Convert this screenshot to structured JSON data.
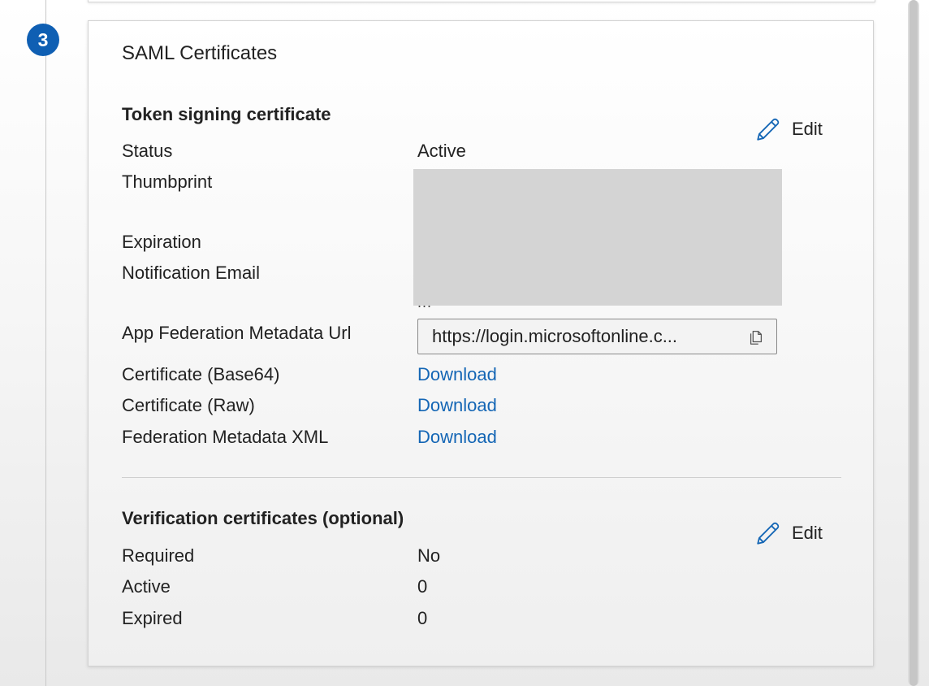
{
  "step": {
    "number": "3"
  },
  "card": {
    "title": "SAML Certificates"
  },
  "token_signing": {
    "title": "Token signing certificate",
    "edit_label": "Edit",
    "rows": [
      {
        "label": "Status",
        "value": "Active"
      },
      {
        "label": "Thumbprint",
        "value": ""
      },
      {
        "label": "Expiration",
        "value": ""
      },
      {
        "label": "Notification Email",
        "value": "..."
      },
      {
        "label": "App Federation Metadata Url",
        "value": "https://login.microsoftonline.c..."
      },
      {
        "label": "Certificate (Base64)",
        "value": "Download"
      },
      {
        "label": "Certificate (Raw)",
        "value": "Download"
      },
      {
        "label": "Federation Metadata XML",
        "value": "Download"
      }
    ]
  },
  "verification": {
    "title": "Verification certificates (optional)",
    "edit_label": "Edit",
    "rows": [
      {
        "label": "Required",
        "value": "No"
      },
      {
        "label": "Active",
        "value": "0"
      },
      {
        "label": "Expired",
        "value": "0"
      }
    ]
  },
  "icons": {
    "edit": "pencil-icon",
    "copy": "copy-icon"
  },
  "colors": {
    "link": "#1466b5",
    "badge": "#0f5fb3"
  }
}
